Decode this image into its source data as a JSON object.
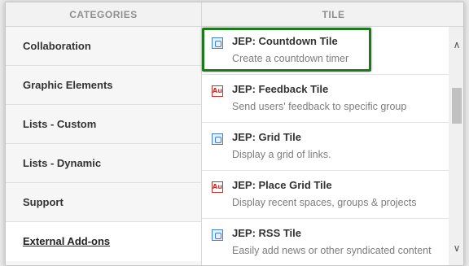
{
  "header": {
    "categories_label": "CATEGORIES",
    "tile_label": "TILE"
  },
  "categories": [
    {
      "label": "Collaboration"
    },
    {
      "label": "Graphic Elements"
    },
    {
      "label": "Lists - Custom"
    },
    {
      "label": "Lists - Dynamic"
    },
    {
      "label": "Support"
    },
    {
      "label": "External Add-ons"
    }
  ],
  "active_category": "External Add-ons",
  "tiles": [
    {
      "title": "JEP: Countdown Tile",
      "desc": "Create a countdown timer",
      "icon": "tile-blue-icon"
    },
    {
      "title": "JEP: Feedback Tile",
      "desc": "Send users' feedback to specific group",
      "icon": "au-red-icon"
    },
    {
      "title": "JEP: Grid Tile",
      "desc": "Display a grid of links.",
      "icon": "tile-blue-icon"
    },
    {
      "title": "JEP: Place Grid Tile",
      "desc": "Display recent spaces, groups & projects",
      "icon": "au-red-icon"
    },
    {
      "title": "JEP: RSS Tile",
      "desc": "Easily add news or other syndicated content",
      "icon": "tile-blue-icon"
    }
  ],
  "icons": {
    "au_text": "Au"
  },
  "colors": {
    "highlight": "#1c7a1c",
    "icon_blue": "#3f7fcf",
    "icon_red": "#c9302c"
  }
}
